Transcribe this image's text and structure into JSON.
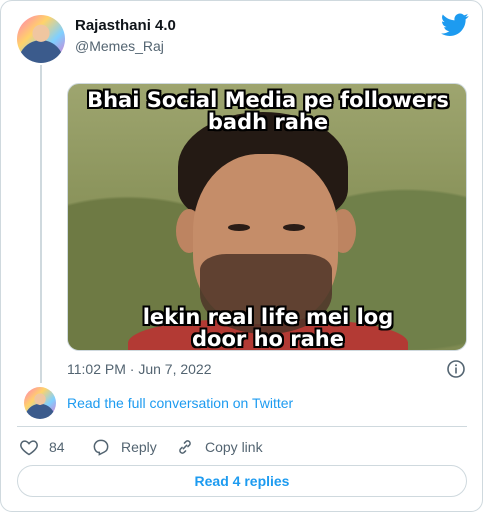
{
  "author": {
    "name": "Rajasthani 4.0",
    "handle": "@Memes_Raj"
  },
  "media": {
    "caption_top": "Bhai Social Media pe followers badh rahe",
    "caption_bottom": "lekin real life mei log door ho rahe"
  },
  "timestamp": "11:02 PM · Jun 7, 2022",
  "conversation_link": "Read the full conversation on Twitter",
  "actions": {
    "like_count": "84",
    "reply_label": "Reply",
    "copy_label": "Copy link"
  },
  "read_replies_label": "Read 4 replies",
  "colors": {
    "accent": "#1d9bf0",
    "secondary_text": "#536471",
    "border": "#cfd9de"
  },
  "icons": [
    "twitter-bird-icon",
    "info-icon",
    "heart-icon",
    "reply-bubble-icon",
    "link-icon"
  ]
}
